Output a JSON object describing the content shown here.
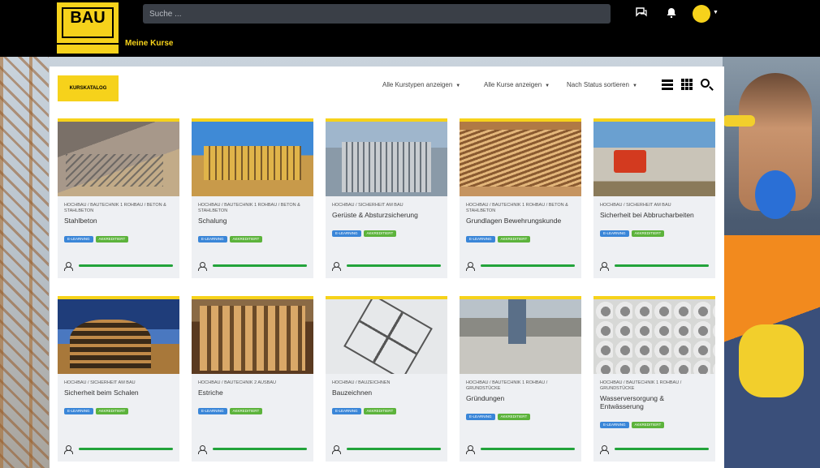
{
  "header": {
    "logo_text": "BAU",
    "my_courses": "Meine Kurse",
    "search_placeholder": "Suche ..."
  },
  "panel": {
    "catalog_badge": "KURSKATALOG",
    "filters": [
      {
        "label": "Alle Kurstypen anzeigen"
      },
      {
        "label": "Alle Kurse anzeigen"
      },
      {
        "label": "Nach Status sortieren"
      }
    ]
  },
  "courses": [
    {
      "category": "HOCHBAU / BAUTECHNIK 1 ROHBAU / BETON & STAHLBETON",
      "title": "Stahlbeton",
      "tags": [
        "E-LEARNING",
        "AKKREDITIERT"
      ],
      "progress": 1.0
    },
    {
      "category": "HOCHBAU / BAUTECHNIK 1 ROHBAU / BETON & STAHLBETON",
      "title": "Schalung",
      "tags": [
        "E-LEARNING",
        "AKKREDITIERT"
      ],
      "progress": 1.0
    },
    {
      "category": "HOCHBAU / SICHERHEIT AM BAU",
      "title": "Gerüste & Absturzsicherung",
      "tags": [
        "E-LEARNING",
        "AKKREDITIERT"
      ],
      "progress": 1.0
    },
    {
      "category": "HOCHBAU / BAUTECHNIK 1 ROHBAU / BETON & STAHLBETON",
      "title": "Grundlagen Bewehrungskunde",
      "tags": [
        "E-LEARNING",
        "AKKREDITIERT"
      ],
      "progress": 1.0
    },
    {
      "category": "HOCHBAU / SICHERHEIT AM BAU",
      "title": "Sicherheit bei Abbrucharbeiten",
      "tags": [
        "E-LEARNING",
        "AKKREDITIERT"
      ],
      "progress": 1.0
    },
    {
      "category": "HOCHBAU / SICHERHEIT AM BAU",
      "title": "Sicherheit beim Schalen",
      "tags": [
        "E-LEARNING",
        "AKKREDITIERT"
      ],
      "progress": 1.0
    },
    {
      "category": "HOCHBAU / BAUTECHNIK 2 AUSBAU",
      "title": "Estriche",
      "tags": [
        "E-LEARNING",
        "AKKREDITIERT"
      ],
      "progress": 1.0
    },
    {
      "category": "HOCHBAU / BAUZEICHNEN",
      "title": "Bauzeichnen",
      "tags": [
        "E-LEARNING",
        "AKKREDITIERT"
      ],
      "progress": 1.0
    },
    {
      "category": "HOCHBAU / BAUTECHNIK 1 ROHBAU / GRUNDSTÜCKE",
      "title": "Gründungen",
      "tags": [
        "E-LEARNING",
        "AKKREDITIERT"
      ],
      "progress": 1.0
    },
    {
      "category": "HOCHBAU / BAUTECHNIK 1 ROHBAU / GRUNDSTÜCKE",
      "title": "Wasserversorgung & Entwässerung",
      "tags": [
        "E-LEARNING",
        "AKKREDITIERT"
      ],
      "progress": 1.0
    }
  ],
  "colors": {
    "brand_yellow": "#f6d21b",
    "progress_green": "#22a33a",
    "tag_blue": "#3a86d8",
    "tag_green": "#5cb33b"
  }
}
